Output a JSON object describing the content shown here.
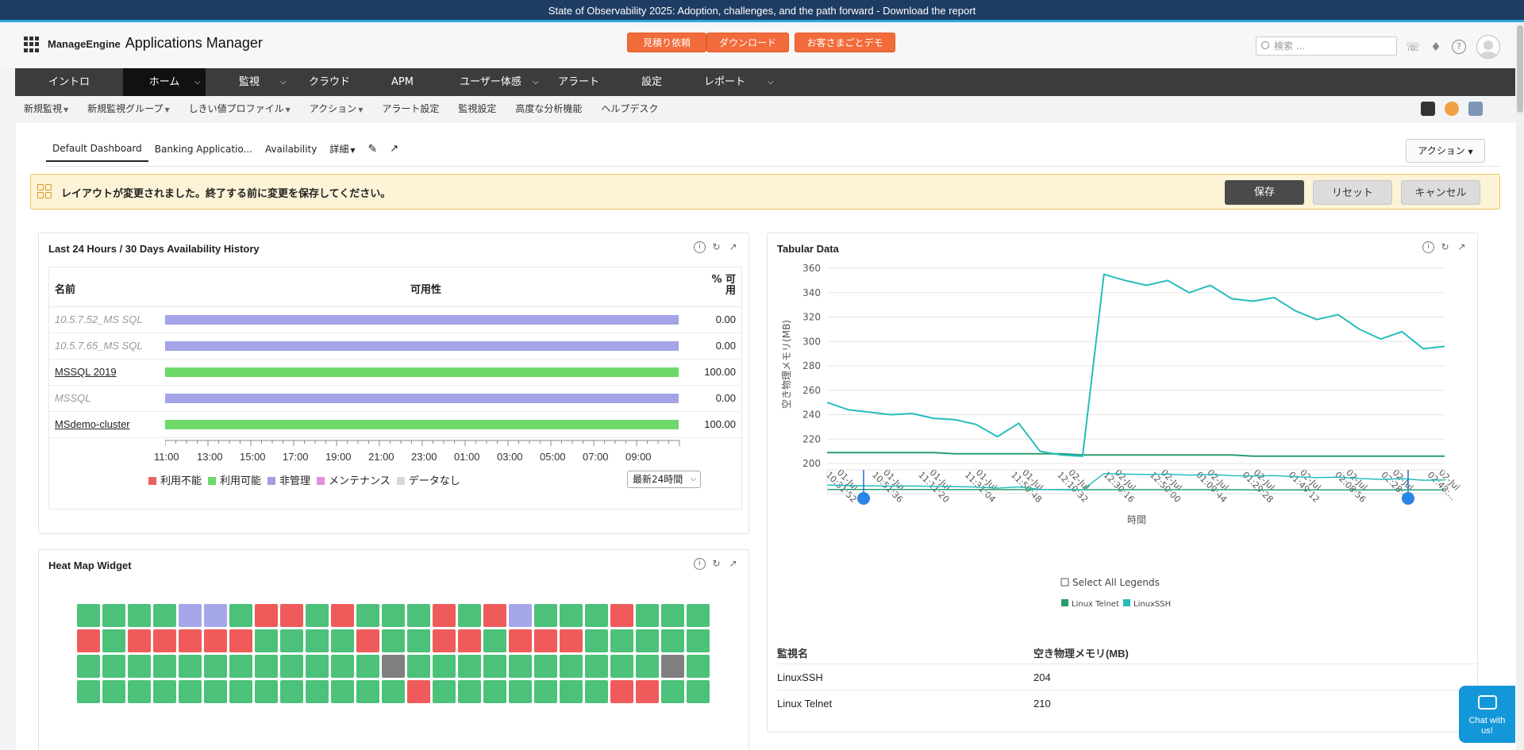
{
  "banner": {
    "text": "State of Observability 2025: Adoption, challenges, and the path forward - Download the report"
  },
  "header": {
    "brand_me": "ManageEngine",
    "brand_app": "Applications Manager",
    "btn_quote": "見積り依頼",
    "btn_download": "ダウンロード",
    "btn_demo": "お客さまごとデモ",
    "search_placeholder": "検索 ..."
  },
  "nav": {
    "items": [
      "イントロ",
      "ホーム",
      "監視",
      "クラウド",
      "APM",
      "ユーザー体感",
      "アラート",
      "設定",
      "レポート"
    ]
  },
  "subnav": {
    "items": [
      "新規監視",
      "新規監視グループ",
      "しきい値プロファイル",
      "アクション",
      "アラート設定",
      "監視設定",
      "高度な分析機能",
      "ヘルプデスク"
    ]
  },
  "tabs": [
    "Default Dashboard",
    "Banking Applicatio...",
    "Availability",
    "詳細"
  ],
  "action_label": "アクション",
  "notice": {
    "text": "レイアウトが変更されました。終了する前に変更を保存してください。",
    "save": "保存",
    "reset": "リセット",
    "cancel": "キャンセル"
  },
  "availability": {
    "title": "Last 24 Hours / 30 Days Availability History",
    "col_name": "名前",
    "col_avail": "可用性",
    "col_pct_1": "% 可",
    "col_pct_2": "用",
    "rows": [
      {
        "name": "10.5.7.52_MS SQL",
        "status": "unmanaged",
        "pct": "0.00"
      },
      {
        "name": "10.5.7.65_MS SQL",
        "status": "unmanaged",
        "pct": "0.00"
      },
      {
        "name": "MSSQL 2019",
        "status": "up",
        "pct": "100.00"
      },
      {
        "name": "MSSQL",
        "status": "unmanaged",
        "pct": "0.00"
      },
      {
        "name": "MSdemo-cluster",
        "status": "up",
        "pct": "100.00"
      }
    ],
    "times": [
      "11:00",
      "13:00",
      "15:00",
      "17:00",
      "19:00",
      "21:00",
      "23:00",
      "01:00",
      "03:00",
      "05:00",
      "07:00",
      "09:00"
    ],
    "legend": [
      {
        "label": "利用不能",
        "color": "#e8625f"
      },
      {
        "label": "利用可能",
        "color": "#6fd86a"
      },
      {
        "label": "非管理",
        "color": "#9f9fe0"
      },
      {
        "label": "メンテナンス",
        "color": "#de8fde"
      },
      {
        "label": "データなし",
        "color": "#d9d9d9"
      }
    ],
    "range": "最新24時間",
    "colors": {
      "up": "#6fd86a",
      "unmanaged": "#a3a3e6"
    }
  },
  "heatmap": {
    "title": "Heat Map Widget",
    "colors": {
      "g": "#4cc17a",
      "r": "#ef5b5b",
      "p": "#a6a6ea",
      "x": "#808080"
    },
    "rows": [
      "ggggppgrrgrgggrgrpgggrggg",
      "rgrrrrrggggrggrrgrrrggggg",
      "ggggggggggggxggggggggggx",
      "gggggggggggggrgggggggrrg"
    ]
  },
  "tabular": {
    "title": "Tabular Data",
    "select_all": "Select All Legends",
    "col_monitor": "監視名",
    "col_mem": "空き物理メモリ(MB)",
    "table_rows": [
      {
        "name": "LinuxSSH",
        "value": "204"
      },
      {
        "name": "Linux Telnet",
        "value": "210"
      }
    ]
  },
  "chart_data": {
    "type": "line",
    "title": "",
    "xlabel": "時間",
    "ylabel": "空き物理メモリ(MB)",
    "ylim": [
      200,
      360
    ],
    "yticks": [
      200,
      220,
      240,
      260,
      280,
      300,
      320,
      340,
      360
    ],
    "x_labels": [
      "01-Jul 10:31:52",
      "01-Jul 10:51:36",
      "01-Jul 11:11:20",
      "01-Jul 11:31:04",
      "01-Jul 11:50:48",
      "02-Jul 12:10:32",
      "02-Jul 12:30:16",
      "02-Jul 12:50:00",
      "02-Jul 01:09:44",
      "02-Jul 01:29:28",
      "02-Jul 01:49:12",
      "02-Jul 02:08:56",
      "02-Jul 02:28:40",
      "02-Jul 02:48:..."
    ],
    "series": [
      {
        "name": "Linux Telnet",
        "color": "#2a9d6c",
        "values": [
          209,
          209,
          209,
          209,
          209,
          209,
          208,
          208,
          208,
          208,
          208,
          208,
          207,
          207,
          207,
          207,
          207,
          207,
          207,
          207,
          206,
          206,
          206,
          206,
          206,
          206,
          206,
          206,
          206,
          206
        ]
      },
      {
        "name": "LinuxSSH",
        "color": "#27bcbc",
        "values": [
          250,
          244,
          242,
          240,
          241,
          237,
          236,
          232,
          222,
          233,
          210,
          207,
          206,
          355,
          350,
          346,
          350,
          340,
          346,
          335,
          333,
          336,
          325,
          318,
          322,
          310,
          302,
          308,
          294,
          296
        ]
      }
    ]
  }
}
